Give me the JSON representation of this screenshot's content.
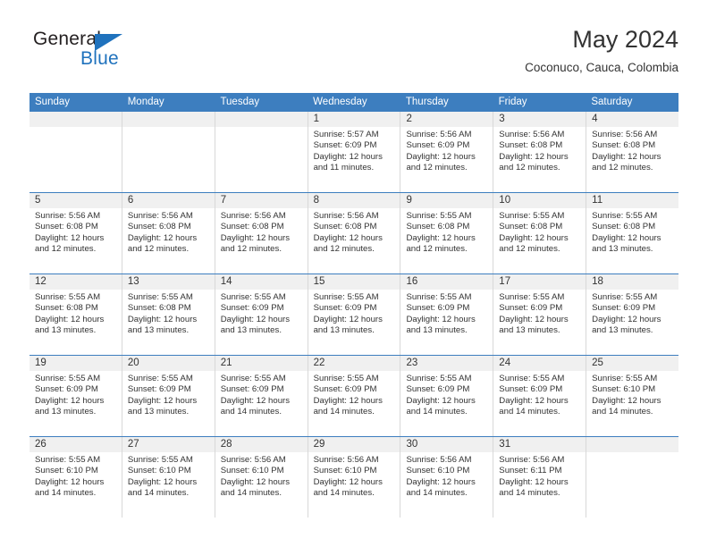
{
  "brand": {
    "name_top": "General",
    "name_bottom": "Blue",
    "accent_color": "#1f72bd"
  },
  "header": {
    "title": "May 2024",
    "subtitle": "Coconuco, Cauca, Colombia"
  },
  "calendar": {
    "header_bg": "#3d7ebf",
    "weekdays": [
      "Sunday",
      "Monday",
      "Tuesday",
      "Wednesday",
      "Thursday",
      "Friday",
      "Saturday"
    ],
    "weeks": [
      [
        {
          "day": "",
          "sunrise": "",
          "sunset": "",
          "daylight_line1": "",
          "daylight_line2": "",
          "empty": true
        },
        {
          "day": "",
          "sunrise": "",
          "sunset": "",
          "daylight_line1": "",
          "daylight_line2": "",
          "empty": true
        },
        {
          "day": "",
          "sunrise": "",
          "sunset": "",
          "daylight_line1": "",
          "daylight_line2": "",
          "empty": true
        },
        {
          "day": "1",
          "sunrise": "Sunrise: 5:57 AM",
          "sunset": "Sunset: 6:09 PM",
          "daylight_line1": "Daylight: 12 hours",
          "daylight_line2": "and 11 minutes."
        },
        {
          "day": "2",
          "sunrise": "Sunrise: 5:56 AM",
          "sunset": "Sunset: 6:09 PM",
          "daylight_line1": "Daylight: 12 hours",
          "daylight_line2": "and 12 minutes."
        },
        {
          "day": "3",
          "sunrise": "Sunrise: 5:56 AM",
          "sunset": "Sunset: 6:08 PM",
          "daylight_line1": "Daylight: 12 hours",
          "daylight_line2": "and 12 minutes."
        },
        {
          "day": "4",
          "sunrise": "Sunrise: 5:56 AM",
          "sunset": "Sunset: 6:08 PM",
          "daylight_line1": "Daylight: 12 hours",
          "daylight_line2": "and 12 minutes."
        }
      ],
      [
        {
          "day": "5",
          "sunrise": "Sunrise: 5:56 AM",
          "sunset": "Sunset: 6:08 PM",
          "daylight_line1": "Daylight: 12 hours",
          "daylight_line2": "and 12 minutes."
        },
        {
          "day": "6",
          "sunrise": "Sunrise: 5:56 AM",
          "sunset": "Sunset: 6:08 PM",
          "daylight_line1": "Daylight: 12 hours",
          "daylight_line2": "and 12 minutes."
        },
        {
          "day": "7",
          "sunrise": "Sunrise: 5:56 AM",
          "sunset": "Sunset: 6:08 PM",
          "daylight_line1": "Daylight: 12 hours",
          "daylight_line2": "and 12 minutes."
        },
        {
          "day": "8",
          "sunrise": "Sunrise: 5:56 AM",
          "sunset": "Sunset: 6:08 PM",
          "daylight_line1": "Daylight: 12 hours",
          "daylight_line2": "and 12 minutes."
        },
        {
          "day": "9",
          "sunrise": "Sunrise: 5:55 AM",
          "sunset": "Sunset: 6:08 PM",
          "daylight_line1": "Daylight: 12 hours",
          "daylight_line2": "and 12 minutes."
        },
        {
          "day": "10",
          "sunrise": "Sunrise: 5:55 AM",
          "sunset": "Sunset: 6:08 PM",
          "daylight_line1": "Daylight: 12 hours",
          "daylight_line2": "and 12 minutes."
        },
        {
          "day": "11",
          "sunrise": "Sunrise: 5:55 AM",
          "sunset": "Sunset: 6:08 PM",
          "daylight_line1": "Daylight: 12 hours",
          "daylight_line2": "and 13 minutes."
        }
      ],
      [
        {
          "day": "12",
          "sunrise": "Sunrise: 5:55 AM",
          "sunset": "Sunset: 6:08 PM",
          "daylight_line1": "Daylight: 12 hours",
          "daylight_line2": "and 13 minutes."
        },
        {
          "day": "13",
          "sunrise": "Sunrise: 5:55 AM",
          "sunset": "Sunset: 6:08 PM",
          "daylight_line1": "Daylight: 12 hours",
          "daylight_line2": "and 13 minutes."
        },
        {
          "day": "14",
          "sunrise": "Sunrise: 5:55 AM",
          "sunset": "Sunset: 6:09 PM",
          "daylight_line1": "Daylight: 12 hours",
          "daylight_line2": "and 13 minutes."
        },
        {
          "day": "15",
          "sunrise": "Sunrise: 5:55 AM",
          "sunset": "Sunset: 6:09 PM",
          "daylight_line1": "Daylight: 12 hours",
          "daylight_line2": "and 13 minutes."
        },
        {
          "day": "16",
          "sunrise": "Sunrise: 5:55 AM",
          "sunset": "Sunset: 6:09 PM",
          "daylight_line1": "Daylight: 12 hours",
          "daylight_line2": "and 13 minutes."
        },
        {
          "day": "17",
          "sunrise": "Sunrise: 5:55 AM",
          "sunset": "Sunset: 6:09 PM",
          "daylight_line1": "Daylight: 12 hours",
          "daylight_line2": "and 13 minutes."
        },
        {
          "day": "18",
          "sunrise": "Sunrise: 5:55 AM",
          "sunset": "Sunset: 6:09 PM",
          "daylight_line1": "Daylight: 12 hours",
          "daylight_line2": "and 13 minutes."
        }
      ],
      [
        {
          "day": "19",
          "sunrise": "Sunrise: 5:55 AM",
          "sunset": "Sunset: 6:09 PM",
          "daylight_line1": "Daylight: 12 hours",
          "daylight_line2": "and 13 minutes."
        },
        {
          "day": "20",
          "sunrise": "Sunrise: 5:55 AM",
          "sunset": "Sunset: 6:09 PM",
          "daylight_line1": "Daylight: 12 hours",
          "daylight_line2": "and 13 minutes."
        },
        {
          "day": "21",
          "sunrise": "Sunrise: 5:55 AM",
          "sunset": "Sunset: 6:09 PM",
          "daylight_line1": "Daylight: 12 hours",
          "daylight_line2": "and 14 minutes."
        },
        {
          "day": "22",
          "sunrise": "Sunrise: 5:55 AM",
          "sunset": "Sunset: 6:09 PM",
          "daylight_line1": "Daylight: 12 hours",
          "daylight_line2": "and 14 minutes."
        },
        {
          "day": "23",
          "sunrise": "Sunrise: 5:55 AM",
          "sunset": "Sunset: 6:09 PM",
          "daylight_line1": "Daylight: 12 hours",
          "daylight_line2": "and 14 minutes."
        },
        {
          "day": "24",
          "sunrise": "Sunrise: 5:55 AM",
          "sunset": "Sunset: 6:09 PM",
          "daylight_line1": "Daylight: 12 hours",
          "daylight_line2": "and 14 minutes."
        },
        {
          "day": "25",
          "sunrise": "Sunrise: 5:55 AM",
          "sunset": "Sunset: 6:10 PM",
          "daylight_line1": "Daylight: 12 hours",
          "daylight_line2": "and 14 minutes."
        }
      ],
      [
        {
          "day": "26",
          "sunrise": "Sunrise: 5:55 AM",
          "sunset": "Sunset: 6:10 PM",
          "daylight_line1": "Daylight: 12 hours",
          "daylight_line2": "and 14 minutes."
        },
        {
          "day": "27",
          "sunrise": "Sunrise: 5:55 AM",
          "sunset": "Sunset: 6:10 PM",
          "daylight_line1": "Daylight: 12 hours",
          "daylight_line2": "and 14 minutes."
        },
        {
          "day": "28",
          "sunrise": "Sunrise: 5:56 AM",
          "sunset": "Sunset: 6:10 PM",
          "daylight_line1": "Daylight: 12 hours",
          "daylight_line2": "and 14 minutes."
        },
        {
          "day": "29",
          "sunrise": "Sunrise: 5:56 AM",
          "sunset": "Sunset: 6:10 PM",
          "daylight_line1": "Daylight: 12 hours",
          "daylight_line2": "and 14 minutes."
        },
        {
          "day": "30",
          "sunrise": "Sunrise: 5:56 AM",
          "sunset": "Sunset: 6:10 PM",
          "daylight_line1": "Daylight: 12 hours",
          "daylight_line2": "and 14 minutes."
        },
        {
          "day": "31",
          "sunrise": "Sunrise: 5:56 AM",
          "sunset": "Sunset: 6:11 PM",
          "daylight_line1": "Daylight: 12 hours",
          "daylight_line2": "and 14 minutes."
        },
        {
          "day": "",
          "sunrise": "",
          "sunset": "",
          "daylight_line1": "",
          "daylight_line2": "",
          "empty": true
        }
      ]
    ]
  }
}
